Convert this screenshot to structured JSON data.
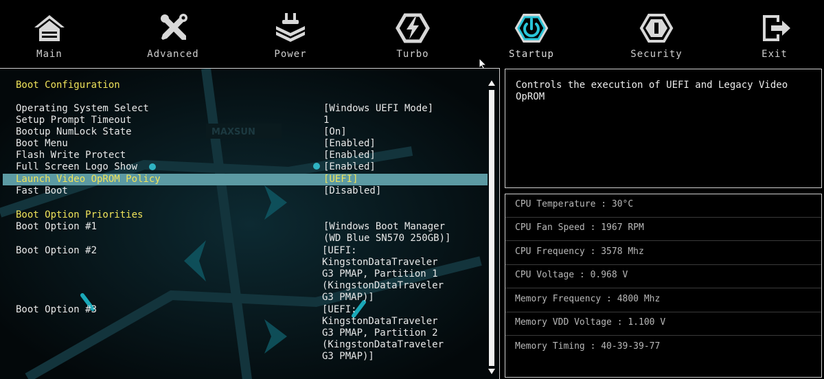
{
  "nav": {
    "tabs": [
      {
        "label": "Main",
        "icon": "home-icon"
      },
      {
        "label": "Advanced",
        "icon": "tools-icon"
      },
      {
        "label": "Power",
        "icon": "power-stack-icon"
      },
      {
        "label": "Turbo",
        "icon": "lightning-icon"
      },
      {
        "label": "Startup",
        "icon": "power-button-icon"
      },
      {
        "label": "Security",
        "icon": "shield-info-icon"
      },
      {
        "label": "Exit",
        "icon": "exit-icon"
      }
    ],
    "active": "Startup",
    "active_color": "#29c4d8"
  },
  "boot": {
    "section_config": "Boot Configuration",
    "items": [
      {
        "label": "Operating System Select",
        "value": "[Windows UEFI Mode]"
      },
      {
        "label": "Setup Prompt Timeout",
        "value": "1"
      },
      {
        "label": "Bootup NumLock State",
        "value": "[On]"
      },
      {
        "label": "Boot Menu",
        "value": "[Enabled]"
      },
      {
        "label": "Flash Write Protect",
        "value": "[Enabled]"
      },
      {
        "label": "Full Screen Logo Show",
        "value": "[Enabled]"
      },
      {
        "label": "Launch Video OpROM Policy",
        "value": "[UEFI]"
      },
      {
        "label": "Fast Boot",
        "value": "[Disabled]"
      }
    ],
    "selected_index": 6,
    "section_priorities": "Boot Option Priorities",
    "options": [
      {
        "label": "Boot Option #1",
        "value_lines": [
          "[Windows Boot Manager",
          "(WD Blue SN570 250GB)]"
        ]
      },
      {
        "label": "Boot Option #2",
        "value_lines": [
          "[UEFI:",
          "KingstonDataTraveler",
          "G3 PMAP, Partition 1",
          "(KingstonDataTraveler",
          "G3 PMAP)]"
        ]
      },
      {
        "label": "Boot Option #3",
        "value_lines": [
          "[UEFI:",
          "KingstonDataTraveler",
          "G3 PMAP, Partition 2",
          "(KingstonDataTraveler",
          "G3 PMAP)]"
        ]
      }
    ]
  },
  "help": {
    "text": "Controls the execution of UEFI and Legacy Video OpROM"
  },
  "hardware": [
    "CPU Temperature : 30°C",
    "CPU Fan Speed : 1967 RPM",
    "CPU Frequency : 3578 Mhz",
    "CPU Voltage : 0.968 V",
    "Memory Frequency : 4800 Mhz",
    "Memory VDD Voltage : 1.100 V",
    "Memory Timing : 40-39-39-77"
  ],
  "colors": {
    "section_yellow": "#f0e35a",
    "highlight_teal": "#5c9aa3"
  }
}
